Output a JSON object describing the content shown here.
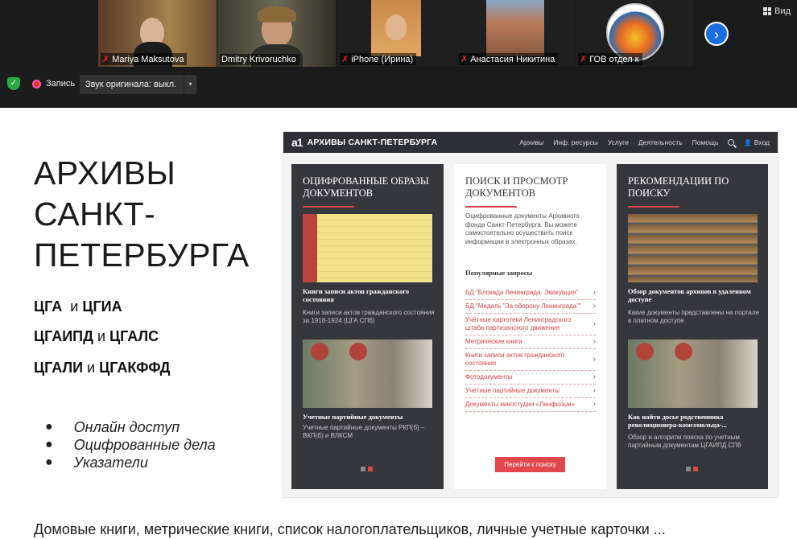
{
  "participants": [
    {
      "name": "Mariya Maksutova",
      "muted": true,
      "active": false
    },
    {
      "name": "Dmitry Krivoruchko",
      "muted": false,
      "active": true
    },
    {
      "name": "iPhone (Ирина)",
      "muted": true,
      "active": false
    },
    {
      "name": "Анастасия Никитина",
      "muted": true,
      "active": false
    },
    {
      "name": "ГОВ отдел к",
      "muted": true,
      "active": false
    }
  ],
  "view_button": "Вид",
  "next_arrow": "›",
  "toolbar": {
    "recording_label": "Запись",
    "audio_label": "Звук оригинала: выкл.",
    "caret": "▾",
    "shield": "✓"
  },
  "slide": {
    "title_lines": [
      "АРХИВЫ",
      "САНКТ-",
      "ПЕТЕРБУРГА"
    ],
    "archives": [
      {
        "a": "ЦГА",
        "conj": "и",
        "b": "ЦГИА"
      },
      {
        "a": "ЦГАИПД",
        "conj": "и",
        "b": "ЦГАЛС"
      },
      {
        "a": "ЦГАЛИ",
        "conj": "и",
        "b": "ЦГАКФФД"
      }
    ],
    "bullet_symbol": "●",
    "bullets": [
      "Онлайн доступ",
      "Оцифрованные дела",
      "Указатели"
    ],
    "footer": "Домовые книги, метрические книги, список налогоплательщиков, личные учетные карточки ..."
  },
  "site": {
    "logo": "a1",
    "name": "АРХИВЫ САНКТ-ПЕТЕРБУРГА",
    "nav": [
      "Архивы",
      "Инф. ресурсы",
      "Услуги",
      "Деятельность",
      "Помощь"
    ],
    "login": "Вход",
    "login_icon": "👤",
    "col1": {
      "title": "Оцифрованные образы документов",
      "item1_title": "Книги записи актов гражданского состояния",
      "item1_text": "Книги записи актов гражданского состояния за 1918-1924 (ЦГА СПб)",
      "item2_title": "Учетные партийные документы",
      "item2_text": "Учетные партийные документы РКП(б) – ВКП(б) и ВЛКСМ"
    },
    "col2": {
      "title": "Поиск и просмотр документов",
      "intro": "Оцифрованные документы Архивного фонда Санкт-Петербурга. Вы можете самостоятельно осуществить поиск информации в электронных образах.",
      "popular_label": "Популярные запросы",
      "queries": [
        "БД \"Блокада Ленинграда. Эвакуация\"",
        "БД \"Медаль \"За оборону Ленинграда\"\"",
        "Учётные картотеки Ленинградского штаба партизанского движения",
        "Метрические книги",
        "Книги записи актов гражданского состояния",
        "Фотодокументы",
        "Учётные партийные документы",
        "Документы киностудии «Ленфильм»"
      ],
      "chevron": "›",
      "button": "Перейти к поиску"
    },
    "col3": {
      "title": "Рекомендации по поиску",
      "item1_title": "Обзор документов архивов в удаленном доступе",
      "item1_text": "Какие документы представлены на портале в платном доступе",
      "item2_title": "Как найти досье родственника революционера-комсомольца-...",
      "item2_text": "Обзор и алгоритм поиска по учетным партийным документам ЦГАИПД СПб"
    }
  },
  "colors": {
    "accent_red": "#d64545",
    "dark_panel": "#36363d",
    "active_speaker": "#7fc241",
    "next_blue": "#1a6fe0"
  }
}
